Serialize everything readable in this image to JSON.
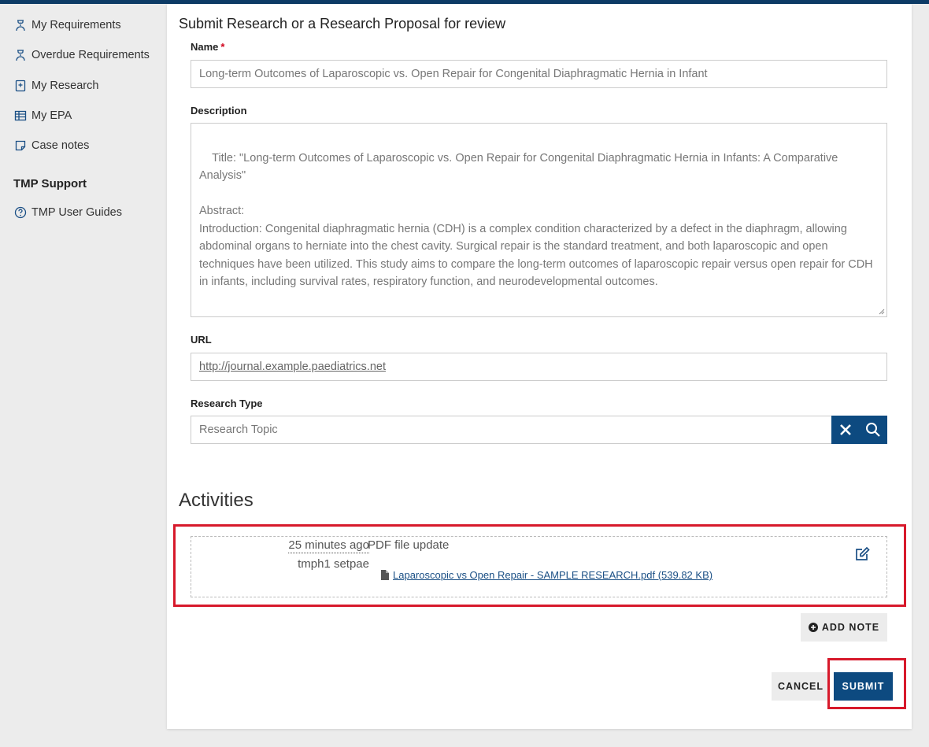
{
  "sidebar": {
    "items": [
      {
        "label": "My Requirements",
        "icon": "graduation-icon"
      },
      {
        "label": "Overdue Requirements",
        "icon": "graduation-icon"
      },
      {
        "label": "My Research",
        "icon": "research-book-icon"
      },
      {
        "label": "My EPA",
        "icon": "table-icon"
      },
      {
        "label": "Case notes",
        "icon": "note-icon"
      }
    ],
    "support_heading": "TMP Support",
    "support_items": [
      {
        "label": "TMP User Guides",
        "icon": "help-circle-icon"
      }
    ]
  },
  "form": {
    "title": "Submit Research or a Research Proposal for review",
    "name_label": "Name",
    "name_required": "*",
    "name_value": "Long-term Outcomes of Laparoscopic vs. Open Repair for Congenital Diaphragmatic Hernia in Infant",
    "description_label": "Description",
    "description_value": "Title: \"Long-term Outcomes of Laparoscopic vs. Open Repair for Congenital Diaphragmatic Hernia in Infants: A Comparative Analysis\"\n\nAbstract:\nIntroduction: Congenital diaphragmatic hernia (CDH) is a complex condition characterized by a defect in the diaphragm, allowing abdominal organs to herniate into the chest cavity. Surgical repair is the standard treatment, and both laparoscopic and open techniques have been utilized. This study aims to compare the long-term outcomes of laparoscopic repair versus open repair for CDH in infants, including survival rates, respiratory function, and neurodevelopmental outcomes.",
    "url_label": "URL",
    "url_value": "http://journal.example.paediatrics.net",
    "type_label": "Research Type",
    "type_value": "Research Topic"
  },
  "activities": {
    "heading": "Activities",
    "items": [
      {
        "time": "25 minutes ago",
        "user": "tmph1 setpae",
        "title": "PDF file update",
        "file": "Laparoscopic vs Open Repair - SAMPLE RESEARCH.pdf (539.82 KB)"
      }
    ],
    "add_note_label": "ADD NOTE"
  },
  "actions": {
    "cancel_label": "CANCEL",
    "submit_label": "SUBMIT"
  },
  "colors": {
    "primary": "#0d4a80",
    "highlight": "#d7192b",
    "topbar": "#0d3b66"
  }
}
